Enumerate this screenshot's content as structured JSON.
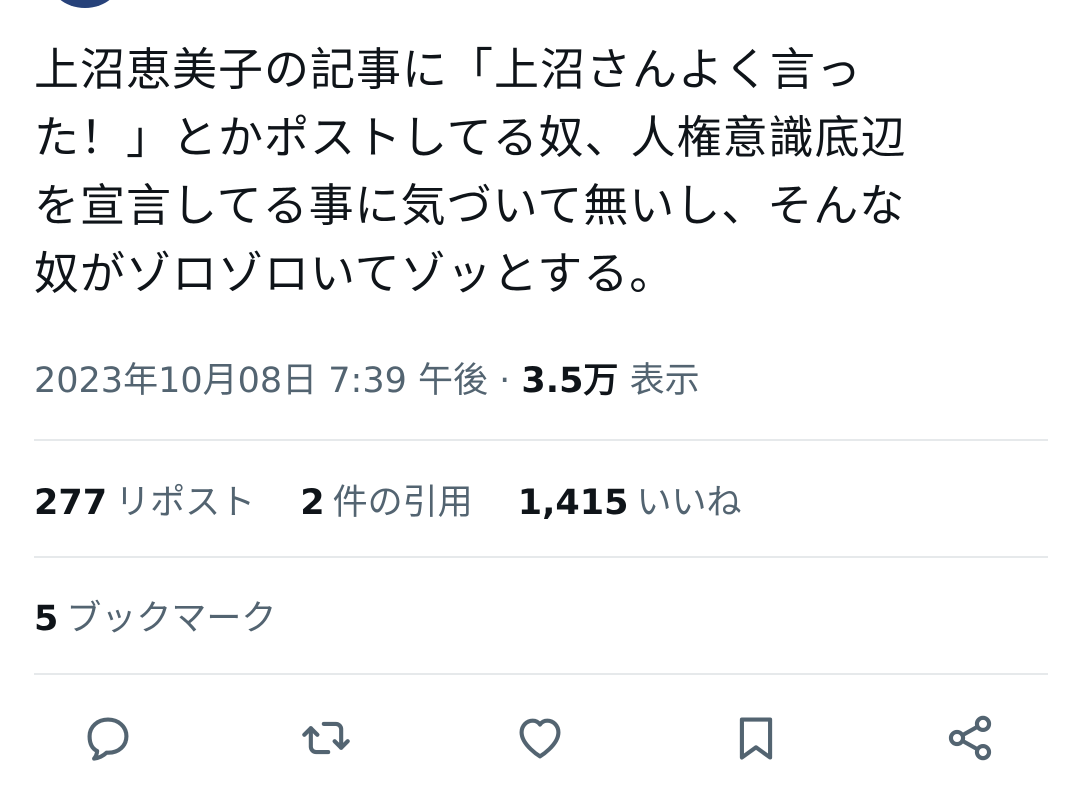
{
  "tweet": {
    "text_lines": [
      "上沼恵美子の記事に「上沼さんよく言っ",
      "た！」とかポストしてる奴、人権意識底辺",
      "を宣言してる事に気づいて無いし、そんな",
      "奴がゾロゾロいてゾッとする。"
    ],
    "timestamp": "2023年10月08日 7:39 午後",
    "separator": "·",
    "views_count": "3.5万",
    "views_label": "表示"
  },
  "stats": {
    "reposts": {
      "count": "277",
      "label": "リポスト"
    },
    "quotes": {
      "count": "2",
      "label": "件の引用"
    },
    "likes": {
      "count": "1,415",
      "label": "いいね"
    },
    "bookmarks": {
      "count": "5",
      "label": "ブックマーク"
    }
  },
  "actions": {
    "reply_icon": "reply-icon",
    "repost_icon": "repost-icon",
    "like_icon": "heart-icon",
    "bookmark_icon": "bookmark-icon",
    "share_icon": "share-icon"
  },
  "colors": {
    "text_primary": "#0f1419",
    "text_secondary": "#536471",
    "divider": "#e6e9eb",
    "avatar": "#27427a"
  }
}
